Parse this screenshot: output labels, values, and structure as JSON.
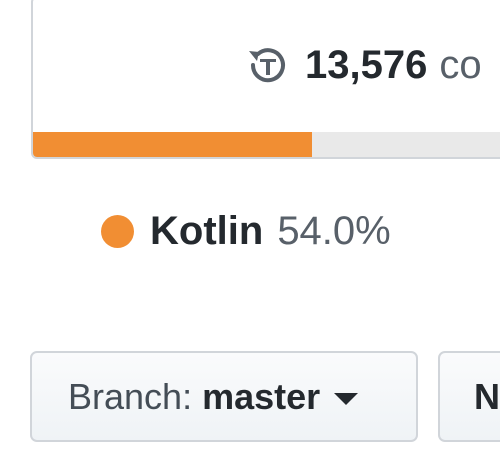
{
  "summary": {
    "commits_count": "13,576",
    "commits_label": "co",
    "icon": "history-icon"
  },
  "language_bar": {
    "fill_fraction": 0.54,
    "color": "#F18E33"
  },
  "languages": [
    {
      "name": "Kotlin",
      "percent": "54.0%",
      "color": "#F18E33"
    }
  ],
  "branch_selector": {
    "prefix": "Branch:",
    "name": "master",
    "icon": "caret-down-icon"
  },
  "new_pull_request_button": {
    "label": "N"
  }
}
